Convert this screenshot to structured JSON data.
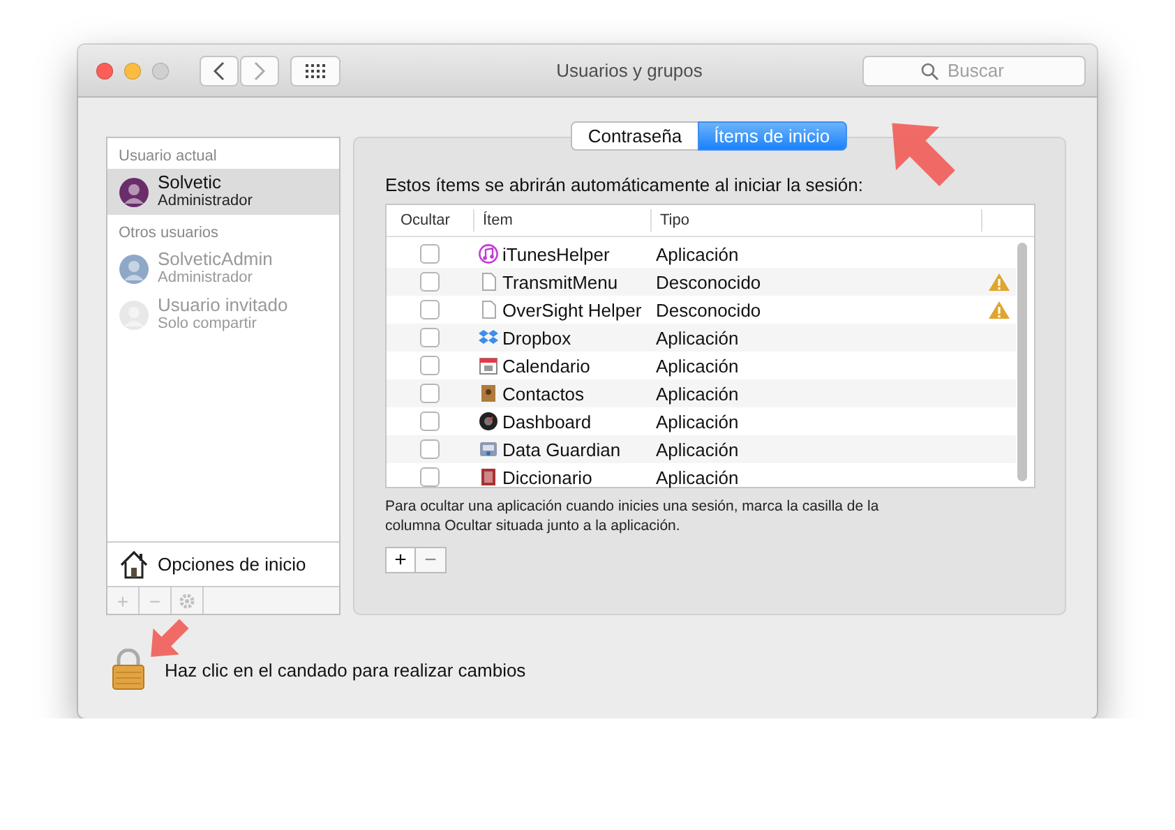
{
  "window": {
    "title": "Usuarios y grupos",
    "search": {
      "placeholder": "Buscar"
    }
  },
  "sidebar": {
    "sections": [
      {
        "title": "Usuario actual",
        "users": [
          {
            "name": "Solvetic",
            "role": "Administrador",
            "selected": true,
            "disabled": false
          }
        ]
      },
      {
        "title": "Otros usuarios",
        "users": [
          {
            "name": "SolveticAdmin",
            "role": "Administrador",
            "selected": false,
            "disabled": true
          },
          {
            "name": "Usuario invitado",
            "role": "Solo compartir",
            "selected": false,
            "disabled": true
          }
        ]
      }
    ],
    "footer_item": "Opciones de inicio",
    "tools": [
      {
        "label": "+",
        "disabled": true
      },
      {
        "label": "−",
        "disabled": true
      },
      {
        "kind": "gear",
        "disabled": true
      }
    ]
  },
  "tabs": [
    {
      "label": "Contraseña",
      "selected": false
    },
    {
      "label": "Ítems de inicio",
      "selected": true
    }
  ],
  "intro": "Estos ítems se abrirán automáticamente al iniciar la sesión:",
  "table": {
    "columns": [
      "Ocultar",
      "Ítem",
      "Tipo"
    ],
    "rows": [
      {
        "item": "iTunesHelper",
        "type": "Aplicación",
        "checked": false,
        "warning": false
      },
      {
        "item": "TransmitMenu",
        "type": "Desconocido",
        "checked": false,
        "warning": true
      },
      {
        "item": "OverSight Helper",
        "type": "Desconocido",
        "checked": false,
        "warning": true
      },
      {
        "item": "Dropbox",
        "type": "Aplicación",
        "checked": false,
        "warning": false
      },
      {
        "item": "Calendario",
        "type": "Aplicación",
        "checked": false,
        "warning": false
      },
      {
        "item": "Contactos",
        "type": "Aplicación",
        "checked": false,
        "warning": false
      },
      {
        "item": "Dashboard",
        "type": "Aplicación",
        "checked": false,
        "warning": false
      },
      {
        "item": "Data Guardian",
        "type": "Aplicación",
        "checked": false,
        "warning": false
      },
      {
        "item": "Diccionario",
        "type": "Aplicación",
        "checked": false,
        "warning": false
      }
    ]
  },
  "hint": "Para ocultar una aplicación cuando inicies una sesión, marca la casilla de la columna Ocultar situada junto a la aplicación.",
  "list_buttons": [
    {
      "label": "+",
      "disabled": false
    },
    {
      "label": "−",
      "disabled": true
    }
  ],
  "lock_text": "Haz clic en el candado para realizar cambios"
}
